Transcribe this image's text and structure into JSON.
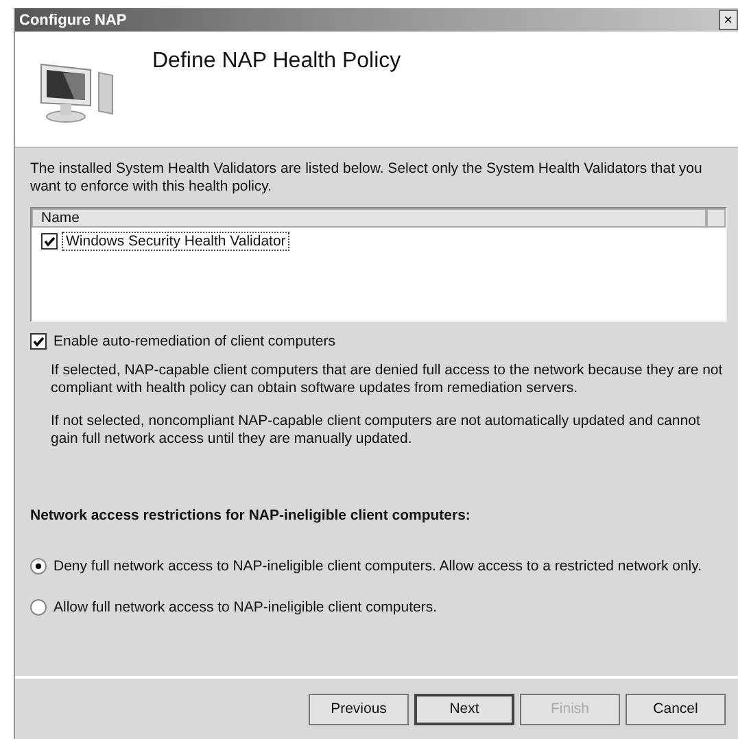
{
  "window": {
    "title": "Configure NAP",
    "close": "×"
  },
  "header": {
    "title": "Define NAP Health Policy"
  },
  "intro": "The installed System Health Validators are listed below. Select only the System Health Validators that you want to enforce with this health policy.",
  "validators": {
    "columns": [
      "Name"
    ],
    "rows": [
      {
        "name": "Windows Security Health Validator",
        "checked": true,
        "selected": true
      }
    ]
  },
  "auto_remediation": {
    "label": "Enable auto-remediation of client computers",
    "checked": true,
    "descriptions": [
      "If selected, NAP-capable client computers that are denied full access to the network because they are not compliant with health policy can obtain software updates from remediation servers.",
      "If not selected, noncompliant NAP-capable client computers are not automatically updated and cannot gain full network access until they are manually updated."
    ]
  },
  "restrictions": {
    "heading": "Network access restrictions for NAP-ineligible client computers:",
    "options": [
      {
        "label": "Deny full network access to NAP-ineligible client computers. Allow access to a restricted network only.",
        "selected": true
      },
      {
        "label": "Allow full network access to NAP-ineligible client computers.",
        "selected": false
      }
    ]
  },
  "buttons": [
    {
      "label": "Previous",
      "disabled": false,
      "default": false
    },
    {
      "label": "Next",
      "disabled": false,
      "default": true
    },
    {
      "label": "Finish",
      "disabled": true,
      "default": false
    },
    {
      "label": "Cancel",
      "disabled": false,
      "default": false
    }
  ]
}
